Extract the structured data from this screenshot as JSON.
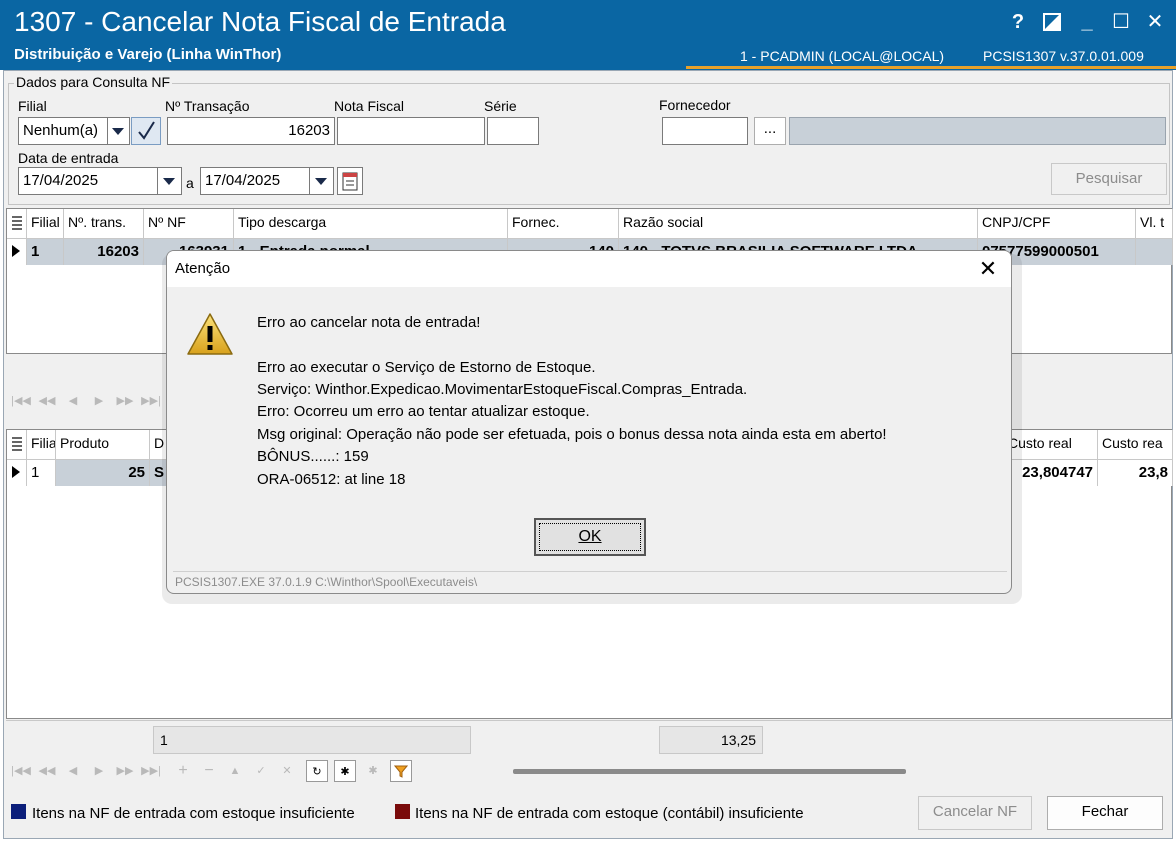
{
  "window": {
    "title": "1307 - Cancelar Nota Fiscal de Entrada",
    "subtitle": "Distribuição e Varejo (Linha WinThor)",
    "session": "1 - PCADMIN (LOCAL@LOCAL)",
    "version": "PCSIS1307  v.37.0.01.009",
    "buttons": {
      "help": "?",
      "minimize": "_",
      "maximize": "☐",
      "close": "✕"
    }
  },
  "filter": {
    "group_label": "Dados para Consulta NF",
    "filial_label": "Filial",
    "filial_value": "Nenhum(a)",
    "transacao_label": "Nº Transação",
    "transacao_value": "16203",
    "nota_label": "Nota Fiscal",
    "nota_value": "",
    "serie_label": "Série",
    "serie_value": "",
    "fornecedor_label": "Fornecedor",
    "fornecedor_value": "",
    "fornecedor_lookup": "...",
    "data_label": "Data de entrada",
    "data_de": "17/04/2025",
    "data_a_label": "a",
    "data_ate": "17/04/2025",
    "pesquisar_label": "Pesquisar"
  },
  "upper_grid": {
    "columns": [
      "Filial",
      "Nº. trans.",
      "Nº NF",
      "Tipo descarga",
      "Fornec.",
      "Razão social",
      "CNPJ/CPF",
      "Vl. t"
    ],
    "row": [
      "1",
      "16203",
      "163931",
      "1 - Entrada normal",
      "140",
      "140 - TOTVS BRASILIA SOFTWARE LTDA",
      "07577599000501",
      ""
    ]
  },
  "lower_grid": {
    "columns": [
      "Filia",
      "Produto",
      "D",
      "Custo real",
      "Custo rea"
    ],
    "row": [
      "1",
      "25",
      "S",
      "23,804747",
      "23,8"
    ]
  },
  "totals": {
    "count": "1",
    "sum": "13,25"
  },
  "legend": {
    "item1": "Itens na NF de entrada com estoque insuficiente",
    "item1_color": "#0b1e7a",
    "item2": "Itens na NF de entrada com estoque (contábil) insuficiente",
    "item2_color": "#7a0b0b"
  },
  "footer_buttons": {
    "cancelar": "Cancelar NF",
    "fechar": "Fechar"
  },
  "dialog": {
    "title": "Atenção",
    "icon": "warning-icon",
    "line1": "Erro ao cancelar nota de entrada!",
    "line2": "Erro ao executar o Serviço de Estorno de Estoque.",
    "line3": "Serviço: Winthor.Expedicao.MovimentarEstoqueFiscal.Compras_Entrada.",
    "line4": "Erro: Ocorreu um erro ao tentar atualizar estoque.",
    "line5": "Msg original: Operação não pode ser efetuada, pois o bonus dessa nota ainda esta em aberto!",
    "line6": "BÔNUS......: 159",
    "line7": "ORA-06512: at line 18",
    "ok_label": "OK",
    "footer": "PCSIS1307.EXE 37.0.1.9 C:\\Winthor\\Spool\\Executaveis\\"
  }
}
